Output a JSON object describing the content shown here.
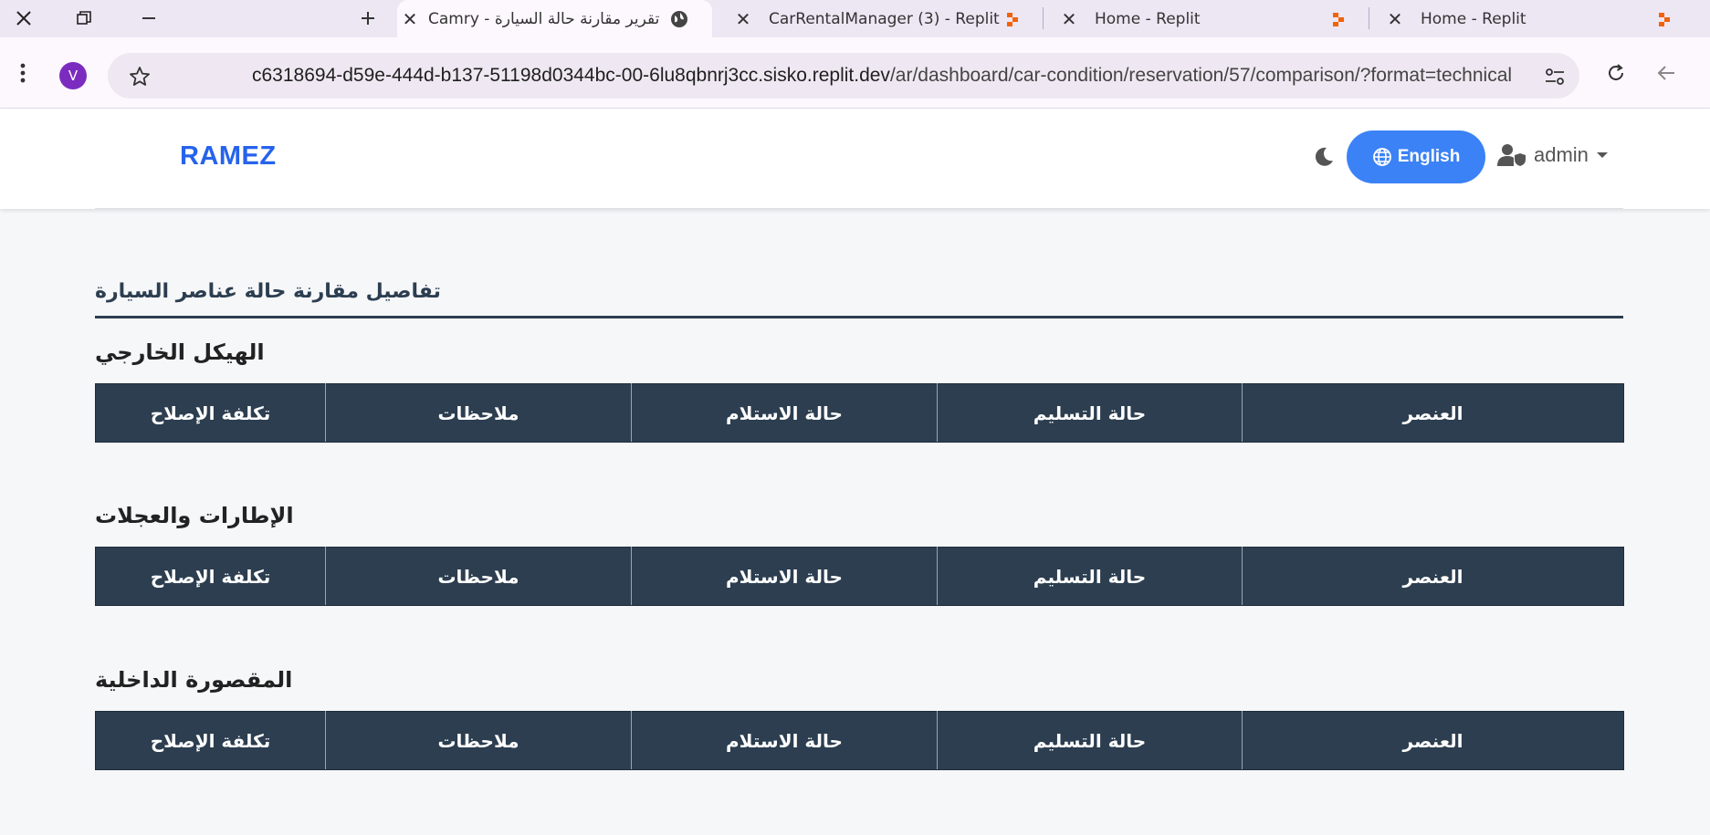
{
  "browser": {
    "tabs": [
      {
        "title": "Camry - تقرير مقارنة حالة السيارة",
        "active": true,
        "favicon": "globe-icon"
      },
      {
        "title": "CarRentalManager (3) - Replit",
        "active": false,
        "favicon": "replit-icon"
      },
      {
        "title": "Home - Replit",
        "active": false,
        "favicon": "replit-icon"
      },
      {
        "title": "Home - Replit",
        "active": false,
        "favicon": "replit-icon"
      }
    ],
    "profile_initial": "V",
    "url_host": "c6318694-d59e-444d-b137-51198d0344bc-00-6lu8qbnrj3cc.sisko.replit.dev",
    "url_path": "/ar/dashboard/car-condition/reservation/57/comparison/?format=technical",
    "accent_color": "#7b2cbf"
  },
  "header": {
    "brand": "RAMEZ",
    "language_button": "English",
    "user_name": "admin",
    "brand_color": "#2563eb",
    "button_color": "#3b82f6"
  },
  "content": {
    "section_title": "تفاصيل مقارنة حالة عناصر السيارة",
    "columns": [
      "العنصر",
      "حالة التسليم",
      "حالة الاستلام",
      "ملاحظات",
      "تكلفة الإصلاح"
    ],
    "groups": [
      {
        "heading": "الهيكل الخارجي"
      },
      {
        "heading": "الإطارات والعجلات"
      },
      {
        "heading": "المقصورة الداخلية"
      }
    ],
    "table_header_color": "#2c3e50"
  }
}
